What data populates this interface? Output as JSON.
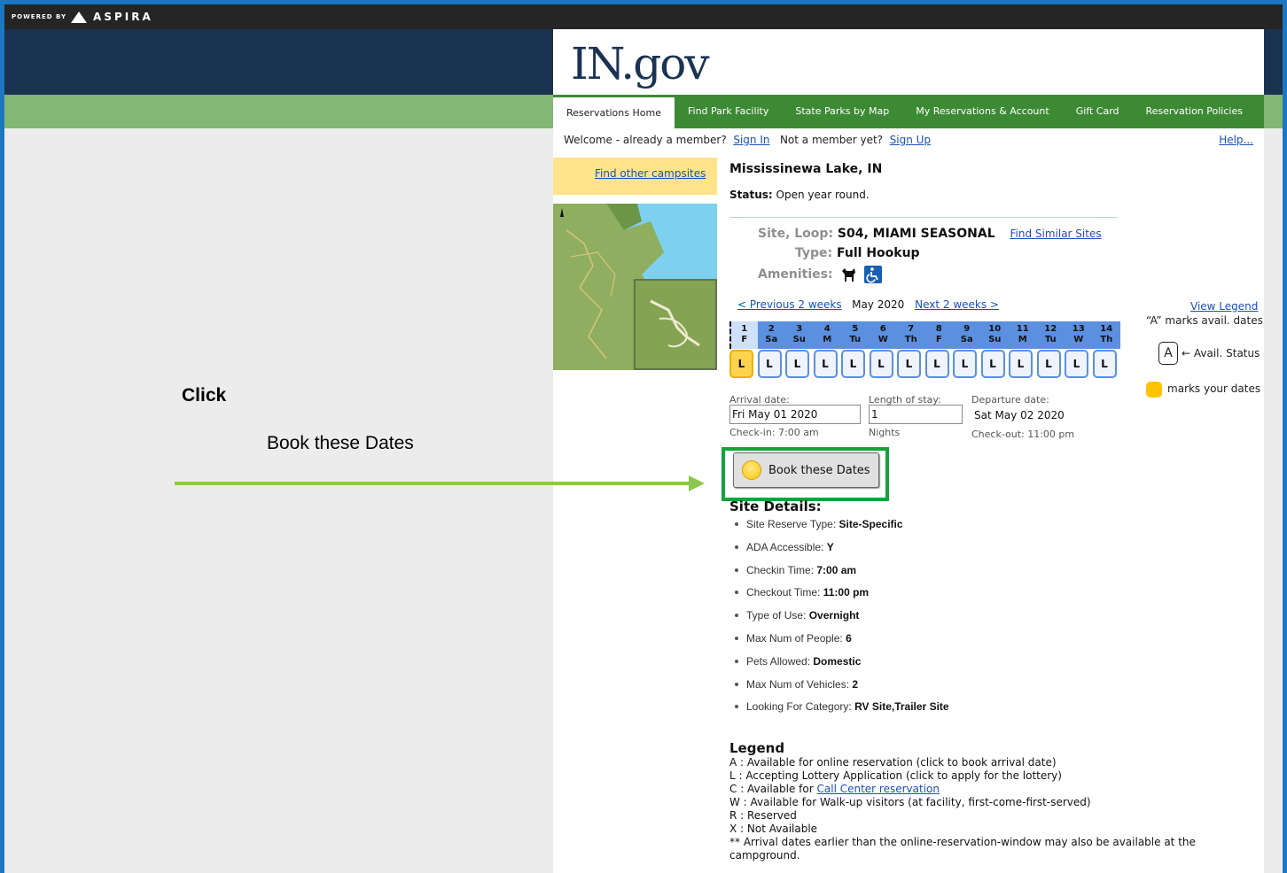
{
  "powered_by": "POWERED BY",
  "brand": "ASPIRA",
  "logo_text": "IN.gov",
  "nav": {
    "tabs": [
      "Reservations Home",
      "Find Park Facility",
      "State Parks by Map",
      "My Reservations & Account",
      "Gift Card",
      "Reservation Policies"
    ]
  },
  "welcome": {
    "text1": "Welcome - already a member?",
    "sign_in": "Sign In",
    "text2": "Not a member yet?",
    "sign_up": "Sign Up",
    "help": "Help..."
  },
  "find_other": "Find other campsites",
  "park": {
    "name": "Mississinewa Lake, IN",
    "status_label": "Status:",
    "status_value": "Open year round."
  },
  "site": {
    "loop_label": "Site, Loop:",
    "loop_value": "S04, MIAMI SEASONAL",
    "find_similar": "Find Similar Sites",
    "type_label": "Type:",
    "type_value": "Full Hookup",
    "amenities_label": "Amenities:"
  },
  "calendar": {
    "prev": "< Previous 2 weeks",
    "month": "May 2020",
    "next": "Next 2 weeks >",
    "view_legend": "View Legend",
    "days": [
      {
        "num": "1",
        "dow": "F"
      },
      {
        "num": "2",
        "dow": "Sa"
      },
      {
        "num": "3",
        "dow": "Su"
      },
      {
        "num": "4",
        "dow": "M"
      },
      {
        "num": "5",
        "dow": "Tu"
      },
      {
        "num": "6",
        "dow": "W"
      },
      {
        "num": "7",
        "dow": "Th"
      },
      {
        "num": "8",
        "dow": "F"
      },
      {
        "num": "9",
        "dow": "Sa"
      },
      {
        "num": "10",
        "dow": "Su"
      },
      {
        "num": "11",
        "dow": "M"
      },
      {
        "num": "12",
        "dow": "Tu"
      },
      {
        "num": "13",
        "dow": "W"
      },
      {
        "num": "14",
        "dow": "Th"
      }
    ],
    "cell_status": "L",
    "legend_marks": "“A” marks avail. dates",
    "legend_avail": "Avail. Status",
    "legend_yours": "marks your dates",
    "legend_a": "A"
  },
  "form": {
    "arrival_label": "Arrival date:",
    "arrival_value": "Fri May 01 2020",
    "checkin": "Check-in: 7:00 am",
    "length_label": "Length of stay:",
    "length_value": "1",
    "nights": "Nights",
    "departure_label": "Departure date:",
    "departure_value": "Sat May 02 2020",
    "checkout": "Check-out: 11:00 pm"
  },
  "book_button": "Book these Dates",
  "details": {
    "heading": "Site Details:",
    "items": [
      {
        "label": "Site Reserve Type:",
        "value": "Site-Specific"
      },
      {
        "label": "ADA Accessible:",
        "value": "Y"
      },
      {
        "label": "Checkin Time:",
        "value": "7:00 am"
      },
      {
        "label": "Checkout Time:",
        "value": "11:00 pm"
      },
      {
        "label": "Type of Use:",
        "value": "Overnight"
      },
      {
        "label": "Max Num of People:",
        "value": "6"
      },
      {
        "label": "Pets Allowed:",
        "value": "Domestic"
      },
      {
        "label": "Max Num of Vehicles:",
        "value": "2"
      },
      {
        "label": "Looking For Category:",
        "value": "RV Site,Trailer Site"
      }
    ]
  },
  "legend": {
    "heading": "Legend",
    "a": "A : Available for online reservation (click to book arrival date)",
    "l": "L : Accepting Lottery Application (click to apply for the lottery)",
    "c_prefix": "C : Available for",
    "c_link": "Call Center reservation",
    "w": "W : Available for Walk-up visitors (at facility, first-come-first-served)",
    "r": "R : Reserved",
    "x": "X : Not Available",
    "note": "** Arrival dates earlier than the online-reservation-window may also be available at the campground."
  },
  "annotation": {
    "click": "Click",
    "book_text": "Book these Dates"
  },
  "colors": {
    "frame": "#1c77c3",
    "navy": "#1b3353",
    "green_nav": "#3d8a35",
    "highlight": "#12a33a",
    "arrow": "#8cc850"
  }
}
